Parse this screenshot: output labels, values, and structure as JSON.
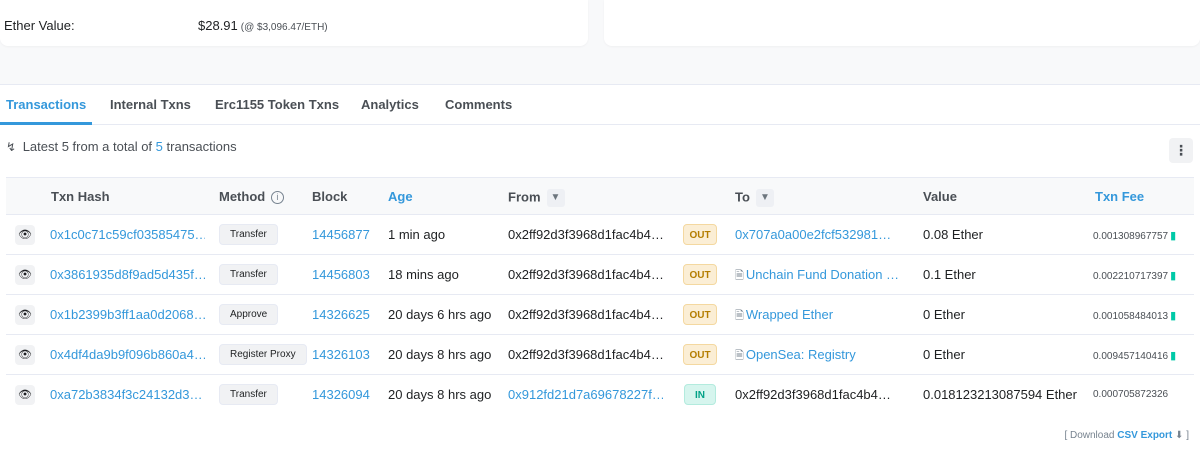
{
  "overview": {
    "ether_value_label": "Ether Value:",
    "ether_value": "$28.91",
    "ether_rate": "(@ $3,096.47/ETH)"
  },
  "tabs": [
    {
      "label": "Transactions",
      "active": true
    },
    {
      "label": "Internal Txns"
    },
    {
      "label": "Erc1155 Token Txns"
    },
    {
      "label": "Analytics"
    },
    {
      "label": "Comments"
    }
  ],
  "summary": {
    "prefix": "Latest 5 from a total of",
    "count": "5",
    "suffix": "transactions"
  },
  "table": {
    "headers": {
      "hash": "Txn Hash",
      "method": "Method",
      "block": "Block",
      "age": "Age",
      "from": "From",
      "to": "To",
      "value": "Value",
      "fee": "Txn Fee"
    },
    "rows": [
      {
        "hash": "0x1c0c71c59cf03585475…",
        "method": "Transfer",
        "block": "14456877",
        "age": "1 min ago",
        "from": "0x2ff92d3f3968d1fac4b4…",
        "direction": "OUT",
        "to": "0x707a0a00e2fcf532981…",
        "value": "0.08 Ether",
        "fee": "0.001308967757"
      },
      {
        "hash": "0x3861935d8f9ad5d435f…",
        "method": "Transfer",
        "block": "14456803",
        "age": "18 mins ago",
        "from": "0x2ff92d3f3968d1fac4b4…",
        "direction": "OUT",
        "to": "Unchain Fund Donation …",
        "value": "0.1 Ether",
        "fee": "0.002210717397"
      },
      {
        "hash": "0x1b2399b3ff1aa0d2068…",
        "method": "Approve",
        "block": "14326625",
        "age": "20 days 6 hrs ago",
        "from": "0x2ff92d3f3968d1fac4b4…",
        "direction": "OUT",
        "to": "Wrapped Ether",
        "value": "0 Ether",
        "fee": "0.001058484013"
      },
      {
        "hash": "0x4df4da9b9f096b860a4…",
        "method": "Register Proxy",
        "block": "14326103",
        "age": "20 days 8 hrs ago",
        "from": "0x2ff92d3f3968d1fac4b4…",
        "direction": "OUT",
        "to": "OpenSea: Registry",
        "value": "0 Ether",
        "fee": "0.009457140416"
      },
      {
        "hash": "0xa72b3834f3c24132d3…",
        "method": "Transfer",
        "block": "14326094",
        "age": "20 days 8 hrs ago",
        "from": "0x912fd21d7a69678227f…",
        "direction": "IN",
        "to": "0x2ff92d3f3968d1fac4b4…",
        "value": "0.018123213087594 Ether",
        "fee": "0.000705872326"
      }
    ]
  },
  "footer": {
    "prefix": "[ Download",
    "csv": "CSV Export",
    "suffix": "]"
  },
  "icons": {
    "sort": "sort-desc-icon",
    "kebab": "more-vertical-icon",
    "filter": "filter-icon",
    "info": "info-circle-icon",
    "eye": "eye-icon",
    "contract": "file-contract-icon",
    "gas": "gas-pump-icon",
    "download": "download-icon"
  },
  "colors": {
    "link": "#3498db",
    "out_badge_bg": "#fbeed5",
    "out_badge_text": "#b47d00",
    "in_badge_bg": "#d6f5ee",
    "in_badge_text": "#00a186",
    "gas_icon": "#00c9a7"
  }
}
